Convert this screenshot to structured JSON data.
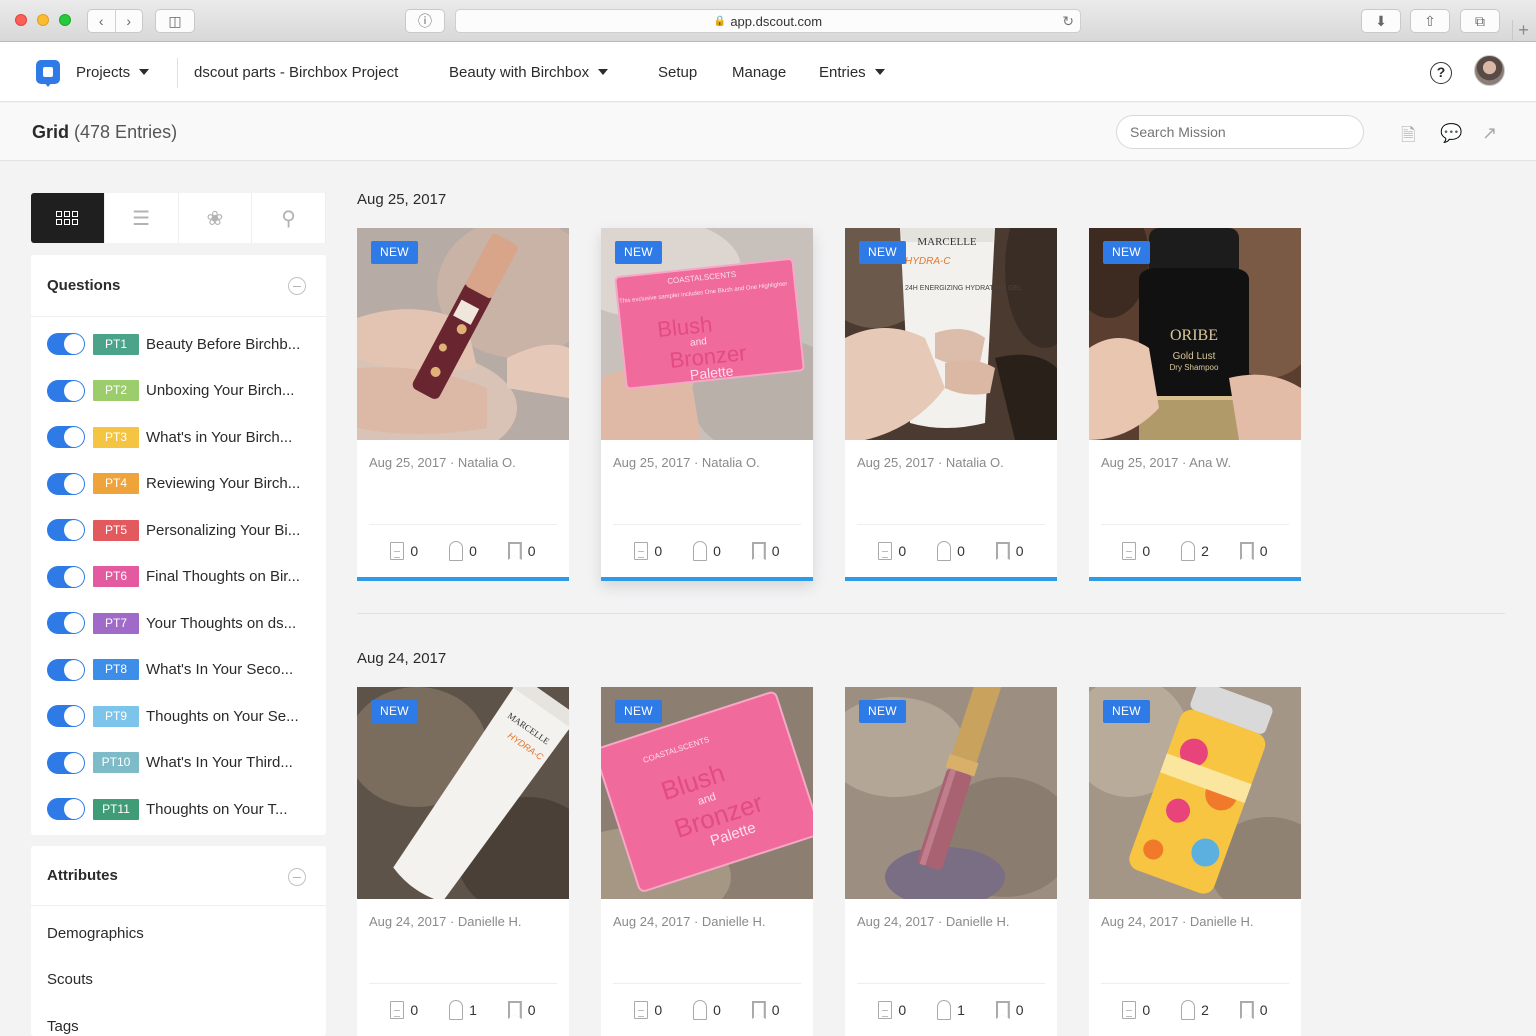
{
  "browser": {
    "url": "app.dscout.com"
  },
  "header": {
    "projects_label": "Projects",
    "project_name": "dscout parts - Birchbox Project",
    "mission_label": "Beauty with Birchbox",
    "setup_label": "Setup",
    "manage_label": "Manage",
    "entries_label": "Entries",
    "help_icon_text": "?"
  },
  "subheader": {
    "title": "Grid",
    "count": "(478 Entries)",
    "search_placeholder": "Search Mission"
  },
  "sidebar": {
    "questions_title": "Questions",
    "questions": [
      {
        "badge": "PT1",
        "label": "Beauty Before Birchb...",
        "color": "#4ba38a"
      },
      {
        "badge": "PT2",
        "label": "Unboxing Your Birch...",
        "color": "#9ccd6d"
      },
      {
        "badge": "PT3",
        "label": "What's in Your Birch...",
        "color": "#f5c443"
      },
      {
        "badge": "PT4",
        "label": "Reviewing Your Birch...",
        "color": "#efa33b"
      },
      {
        "badge": "PT5",
        "label": "Personalizing Your Bi...",
        "color": "#e25a5e"
      },
      {
        "badge": "PT6",
        "label": "Final Thoughts on Bir...",
        "color": "#e45aa0"
      },
      {
        "badge": "PT7",
        "label": "Your Thoughts on ds...",
        "color": "#a06ac8"
      },
      {
        "badge": "PT8",
        "label": "What's In Your Seco...",
        "color": "#3d8ee8"
      },
      {
        "badge": "PT9",
        "label": "Thoughts on Your Se...",
        "color": "#7cc4ea"
      },
      {
        "badge": "PT10",
        "label": "What's In Your Third...",
        "color": "#7dbbc9"
      },
      {
        "badge": "PT11",
        "label": "Thoughts on Your T...",
        "color": "#3f9c77"
      }
    ],
    "attributes_title": "Attributes",
    "attributes": [
      "Demographics",
      "Scouts",
      "Tags"
    ]
  },
  "groups": [
    {
      "date": "Aug 25, 2017",
      "cards": [
        {
          "badge": "NEW",
          "meta": "Aug 25, 2017 · Natalia O.",
          "notes": "0",
          "tags": "0",
          "bookmarks": "0"
        },
        {
          "badge": "NEW",
          "meta": "Aug 25, 2017 · Natalia O.",
          "notes": "0",
          "tags": "0",
          "bookmarks": "0"
        },
        {
          "badge": "NEW",
          "meta": "Aug 25, 2017 · Natalia O.",
          "notes": "0",
          "tags": "0",
          "bookmarks": "0"
        },
        {
          "badge": "NEW",
          "meta": "Aug 25, 2017 · Ana W.",
          "notes": "0",
          "tags": "2",
          "bookmarks": "0"
        }
      ]
    },
    {
      "date": "Aug 24, 2017",
      "cards": [
        {
          "badge": "NEW",
          "meta": "Aug 24, 2017 · Danielle H.",
          "notes": "0",
          "tags": "1",
          "bookmarks": "0"
        },
        {
          "badge": "NEW",
          "meta": "Aug 24, 2017 · Danielle H.",
          "notes": "0",
          "tags": "0",
          "bookmarks": "0"
        },
        {
          "badge": "NEW",
          "meta": "Aug 24, 2017 · Danielle H.",
          "notes": "0",
          "tags": "1",
          "bookmarks": "0"
        },
        {
          "badge": "NEW",
          "meta": "Aug 24, 2017 · Danielle H.",
          "notes": "0",
          "tags": "2",
          "bookmarks": "0"
        }
      ]
    }
  ],
  "photo_text": {
    "p2_brand": "COASTALSCENTS",
    "p2_line": "This exclusive sampler includes One Blush and One Highlighter",
    "p2_title1": "Blush",
    "p2_and": "and",
    "p2_title2": "Bronzer",
    "p2_title3": "Palette",
    "p3_brand": "MARCELLE",
    "p3_product": "HYDRA-C",
    "p3_desc": "24H ENERGIZING HYDRATING GEL",
    "p4_brand": "ORIBE",
    "p4_product": "Gold Lust",
    "p4_sub": "Dry Shampoo"
  },
  "colors": {
    "accent": "#2e7ae6",
    "card_bar": "#2f9be6"
  }
}
